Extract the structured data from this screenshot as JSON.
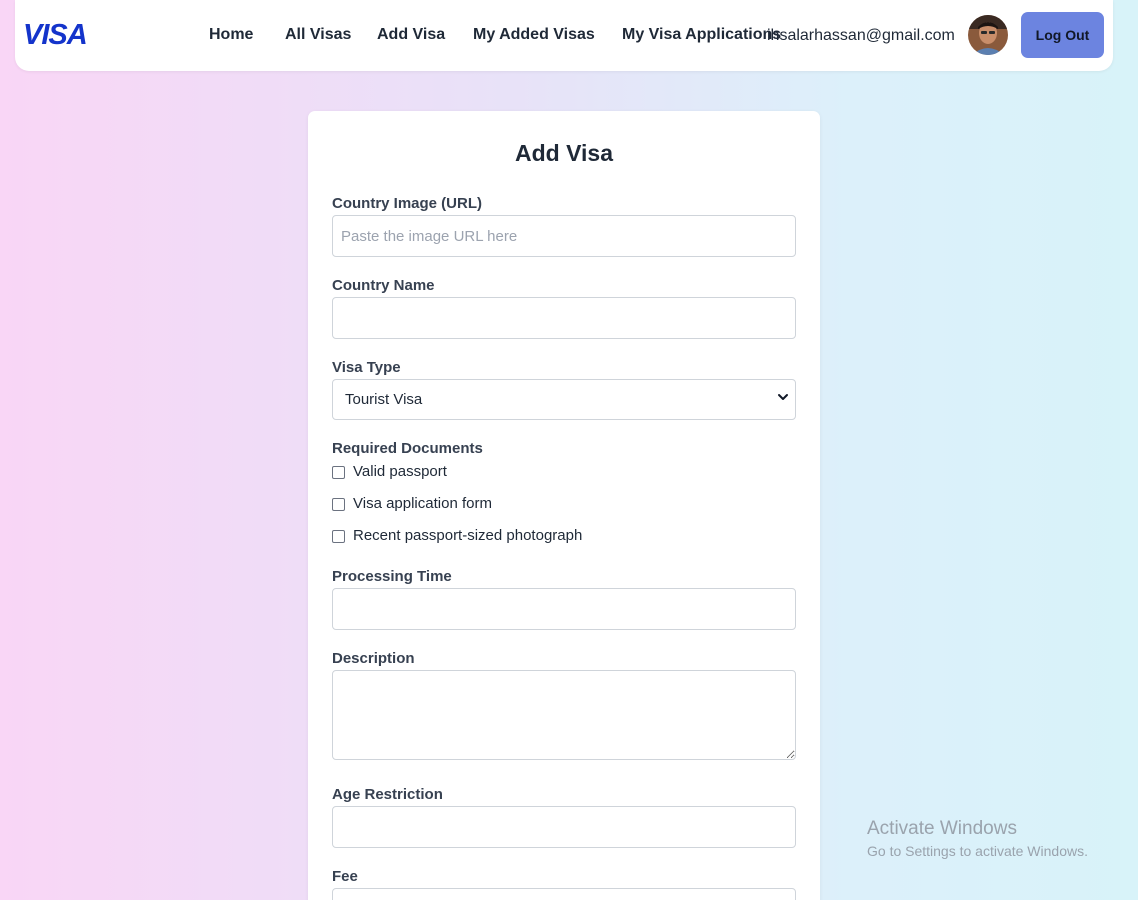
{
  "navbar": {
    "logo": "VISA",
    "links": [
      {
        "label": "Home"
      },
      {
        "label": "All Visas"
      },
      {
        "label": "Add Visa"
      },
      {
        "label": "My Added Visas"
      },
      {
        "label": "My Visa Applications"
      }
    ],
    "user_email": "ihsalarhassan@gmail.com",
    "avatar_icon": "user-avatar",
    "logout_label": "Log Out",
    "logout_color": "#6c84e0",
    "logo_color": "#1434cb"
  },
  "form": {
    "title": "Add Visa",
    "country_image": {
      "label": "Country Image (URL)",
      "placeholder": "Paste the image URL here",
      "value": ""
    },
    "country_name": {
      "label": "Country Name",
      "value": ""
    },
    "visa_type": {
      "label": "Visa Type",
      "selected": "Tourist Visa",
      "icon": "chevron-down-icon"
    },
    "required_documents": {
      "label": "Required Documents",
      "options": [
        {
          "label": "Valid passport",
          "checked": false
        },
        {
          "label": "Visa application form",
          "checked": false
        },
        {
          "label": "Recent passport-sized photograph",
          "checked": false
        }
      ]
    },
    "processing_time": {
      "label": "Processing Time",
      "value": ""
    },
    "description": {
      "label": "Description",
      "value": ""
    },
    "age_restriction": {
      "label": "Age Restriction",
      "value": ""
    },
    "fee": {
      "label": "Fee",
      "value": ""
    }
  },
  "watermark": {
    "title": "Activate Windows",
    "subtitle": "Go to Settings to activate Windows."
  }
}
